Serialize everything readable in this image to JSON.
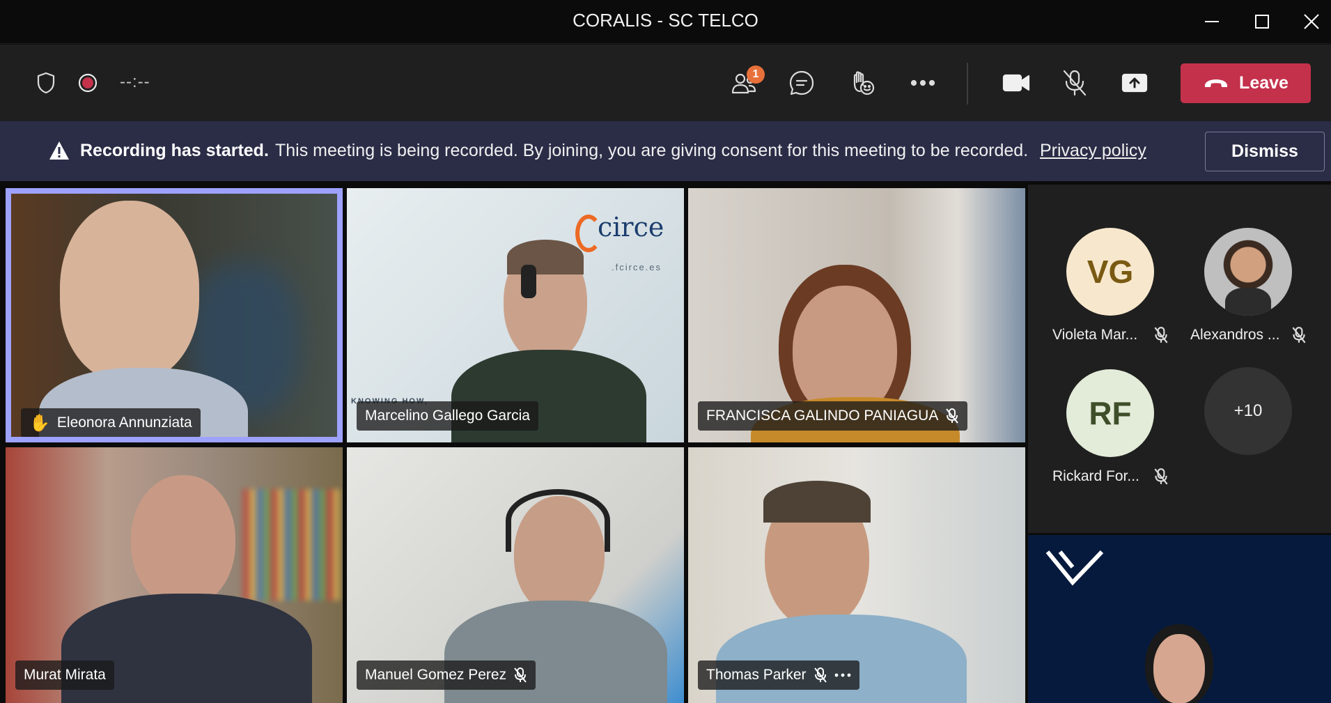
{
  "window": {
    "title": "CORALIS - SC TELCO"
  },
  "toolbar": {
    "timer": "--:--",
    "participants_badge": "1",
    "leave_label": "Leave"
  },
  "banner": {
    "bold_text": "Recording has started.",
    "message": "This meeting is being recorded. By joining, you are giving consent for this meeting to be recorded.",
    "link_text": "Privacy policy",
    "dismiss_label": "Dismiss"
  },
  "tiles": [
    {
      "name": "Eleonora Annunziata",
      "hand_raised": true,
      "muted": false
    },
    {
      "name": "Marcelino Gallego Garcia",
      "muted": false
    },
    {
      "name": "FRANCISCA GALINDO PANIAGUA",
      "muted": true
    },
    {
      "name": "Murat Mirata",
      "muted": false
    },
    {
      "name": "Manuel Gomez Perez",
      "muted": true
    },
    {
      "name": "Thomas Parker",
      "muted": true
    }
  ],
  "gallery": [
    {
      "initials": "VG",
      "name": "Violeta Mar...",
      "muted": true,
      "bg_color": "#f7e8cd",
      "fg_color": "#7a5a12"
    },
    {
      "initials": "",
      "name": "Alexandros ...",
      "muted": true
    },
    {
      "initials": "RF",
      "name": "Rickard For...",
      "muted": true,
      "bg_color": "#e3ecd9",
      "fg_color": "#3e4e2a"
    },
    {
      "overflow": "+10"
    }
  ],
  "shared_logo_text": "circe",
  "shared_logo_sub": ".fcirce.es",
  "shared_logo_tagline": "KNOWING HOW,"
}
